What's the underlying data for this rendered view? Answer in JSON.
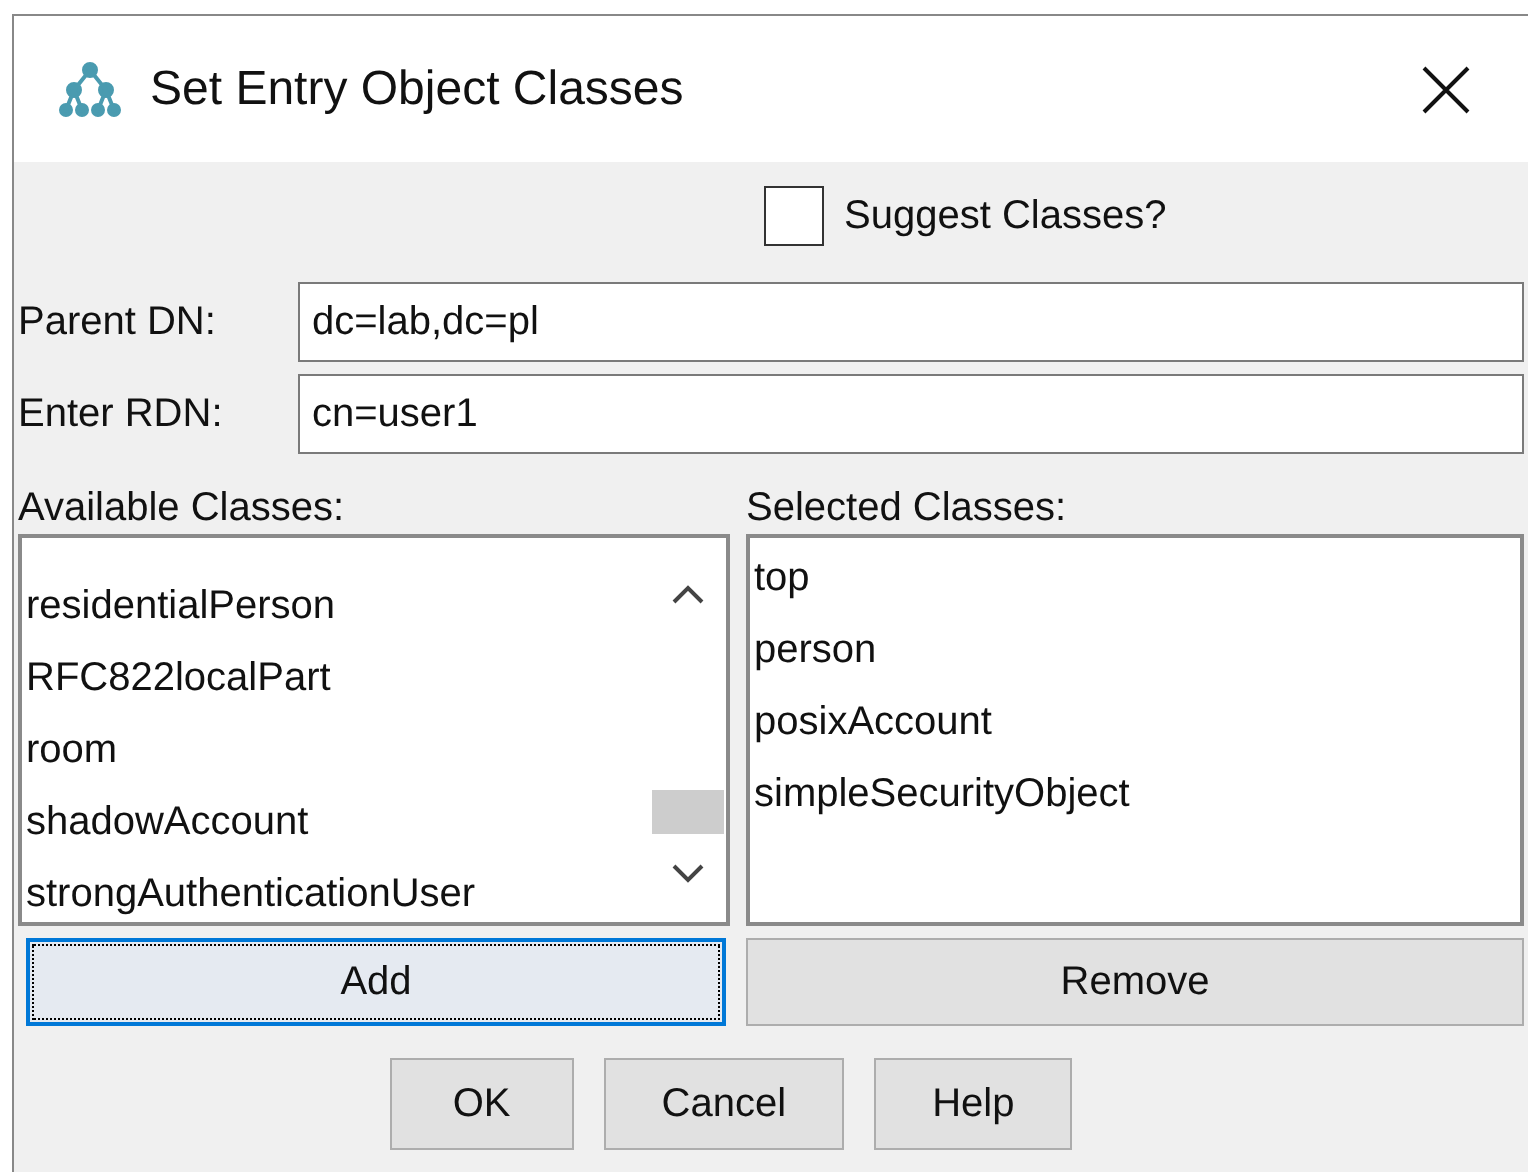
{
  "window": {
    "title": "Set Entry Object Classes"
  },
  "suggest": {
    "label": "Suggest Classes?",
    "checked": false
  },
  "fields": [
    {
      "label": "Parent DN:",
      "value": "dc=lab,dc=pl"
    },
    {
      "label": "Enter RDN:",
      "value": "cn=user1"
    }
  ],
  "available": {
    "label": "Available Classes:",
    "items": [
      "residentialPerson",
      "RFC822localPart",
      "room",
      "shadowAccount",
      "strongAuthenticationUser"
    ]
  },
  "selected": {
    "label": "Selected Classes:",
    "items": [
      "top",
      "person",
      "posixAccount",
      "simpleSecurityObject"
    ]
  },
  "list_buttons": [
    {
      "label": "Add",
      "focused": true
    },
    {
      "label": "Remove",
      "focused": false
    }
  ],
  "buttons": [
    "OK",
    "Cancel",
    "Help"
  ]
}
